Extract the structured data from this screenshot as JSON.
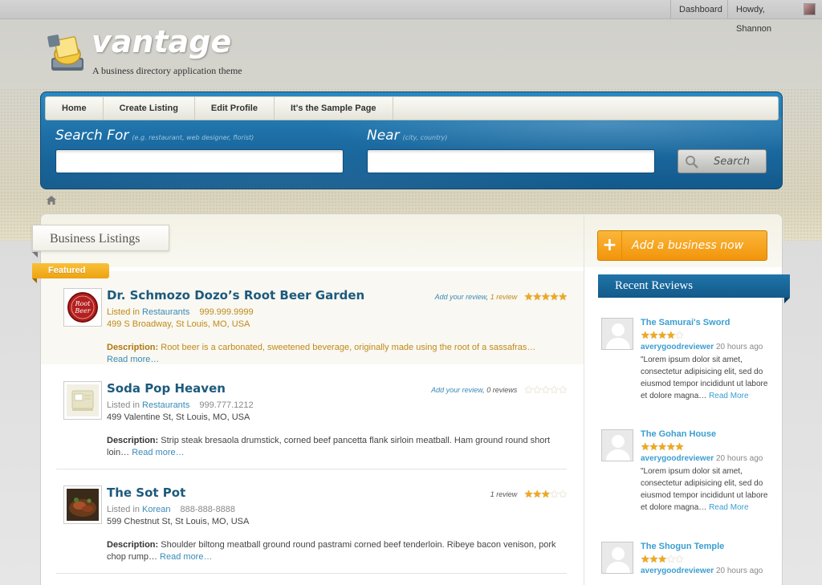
{
  "adminbar": {
    "dashboard": "Dashboard",
    "howdy": "Howdy, Shannon"
  },
  "site": {
    "name": "vantage",
    "tagline": "A business directory application theme"
  },
  "nav": {
    "items": [
      {
        "label": "Home"
      },
      {
        "label": "Create Listing"
      },
      {
        "label": "Edit Profile"
      },
      {
        "label": "It's the Sample Page"
      }
    ]
  },
  "search": {
    "for_label": "Search For",
    "for_hint": "(e.g. restaurant, web designer, florist)",
    "for_value": "",
    "near_label": "Near",
    "near_hint": "(city, country)",
    "near_value": "",
    "button": "Search",
    "button_icon": "magnifier-icon"
  },
  "main": {
    "section_title": "Business Listings",
    "featured_label": "Featured",
    "listings": [
      {
        "title": "Dr. Schmozo Dozo’s Root Beer Garden",
        "add_review": "Add your review",
        "review_count": "1 review",
        "rating": 5,
        "listed_in": "Listed in",
        "category": "Restaurants",
        "phone": "999.999.9999",
        "address": "499 S Broadway, St Louis, MO, USA",
        "desc_label": "Description:",
        "description": "Root beer is a carbonated, sweetened beverage, originally made using the root of a sassafras…",
        "read_more": "Read more…",
        "featured": true,
        "thumb": "root-beer-logo"
      },
      {
        "title": "Soda Pop Heaven",
        "add_review": "Add your review",
        "review_count": "0 reviews",
        "rating": 0,
        "listed_in": "Listed in",
        "category": "Restaurants",
        "phone": "999.777.1212",
        "address": "499 Valentine St, St Louis, MO, USA",
        "desc_label": "Description:",
        "description": "Strip steak bresaola drumstick, corned beef pancetta flank sirloin meatball. Ham ground round short loin…",
        "read_more": "Read more…",
        "featured": false,
        "thumb": "placeholder-image"
      },
      {
        "title": "The Sot Pot",
        "add_review": "",
        "review_count": "1 review",
        "rating": 3,
        "listed_in": "Listed in",
        "category": "Korean",
        "phone": "888-888-8888",
        "address": "599 Chestnut St, St Louis, MO, USA",
        "desc_label": "Description:",
        "description": "Shoulder biltong meatball ground round pastrami corned beef tenderloin. Ribeye bacon venison, pork chop rump…",
        "read_more": "Read more…",
        "featured": false,
        "thumb": "food-photo"
      }
    ]
  },
  "sidebar": {
    "add_business": "Add a business now",
    "recent_reviews_title": "Recent Reviews",
    "reviews": [
      {
        "title": "The Samurai's Sword",
        "rating": 4,
        "user": "averygoodreviewer",
        "time": "20 hours ago",
        "text": "\"Lorem ipsum dolor sit amet, consectetur adipisicing elit, sed do eiusmod tempor incididunt ut labore et dolore magna…",
        "read_more": "Read More"
      },
      {
        "title": "The Gohan House",
        "rating": 5,
        "user": "averygoodreviewer",
        "time": "20 hours ago",
        "text": "\"Lorem ipsum dolor sit amet, consectetur adipisicing elit, sed do eiusmod tempor incididunt ut labore et dolore magna…",
        "read_more": "Read More"
      },
      {
        "title": "The Shogun Temple",
        "rating": 3,
        "user": "averygoodreviewer",
        "time": "20 hours ago",
        "text": "",
        "read_more": ""
      }
    ]
  },
  "colors": {
    "brand_blue": "#1d6fa6",
    "accent_orange": "#f2950b",
    "link_blue": "#3a8ab8",
    "featured_gold": "#c08a1a"
  }
}
